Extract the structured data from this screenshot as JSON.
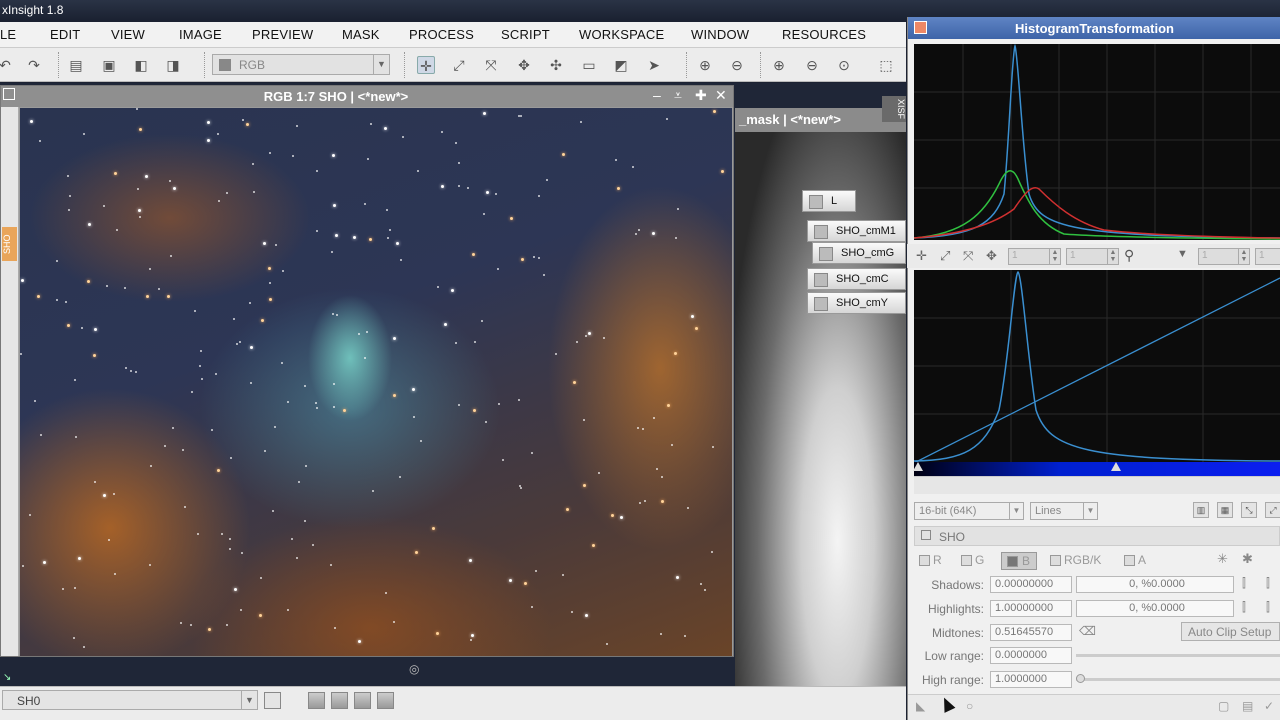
{
  "app": {
    "title": "xInsight 1.8"
  },
  "menu": [
    "LE",
    "EDIT",
    "VIEW",
    "IMAGE",
    "PREVIEW",
    "MASK",
    "PROCESS",
    "SCRIPT",
    "WORKSPACE",
    "WINDOW",
    "RESOURCES"
  ],
  "toolbar": {
    "rgb_select": "RGB"
  },
  "image_window": {
    "title": "RGB 1:7 SHO | <*new*>",
    "side_tab": "SHO"
  },
  "mask_window": {
    "title": "_mask | <*new*>",
    "chips": [
      "L",
      "SHO_cmM1",
      "SHO_cmG",
      "SHO_cmC",
      "SHO_cmY"
    ]
  },
  "bottom": {
    "view_select": "SH0"
  },
  "histogram": {
    "title": "HistogramTransformation",
    "zoom_h": "1",
    "zoom_v": "1",
    "zoom3": "1",
    "zoom4": "1",
    "resolution": "16-bit (64K)",
    "graph_style": "Lines",
    "view": "SHO",
    "channels": [
      "R",
      "G",
      "B",
      "RGB/K",
      "A"
    ],
    "shadows_label": "Shadows:",
    "shadows": "0.00000000",
    "shadows_clip": "0, %0.0000",
    "highlights_label": "Highlights:",
    "highlights": "1.00000000",
    "highlights_clip": "0, %0.0000",
    "midtones_label": "Midtones:",
    "midtones": "0.51645570",
    "auto_clip": "Auto Clip Setup",
    "low_range_label": "Low range:",
    "low_range": "0.0000000",
    "high_range_label": "High range:",
    "high_range": "1.0000000"
  },
  "colors": {
    "title_blue": "#4a70b4",
    "accent_orange": "#e9a55a",
    "histogram_bg": "#0c0c0c"
  }
}
